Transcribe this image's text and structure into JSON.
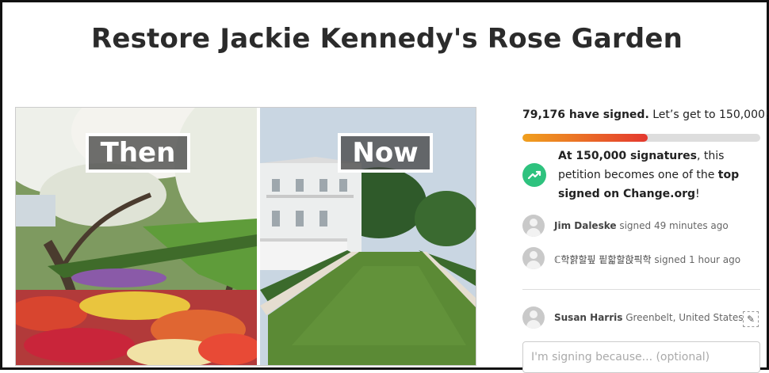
{
  "petition": {
    "title": "Restore Jackie Kennedy's Rose Garden"
  },
  "hero": {
    "then_label": "Then",
    "now_label": "Now"
  },
  "progress": {
    "signed_count": "79,176 have signed.",
    "goal_text": " Let’s get to 150,000!",
    "fraction": 0.528,
    "bar_color_start": "#f0a01e",
    "bar_color_end": "#e4382f"
  },
  "milestone": {
    "icon": "trending-up-icon",
    "part1": "At 150,000 signatures",
    "part2": ", this petition becomes one of the ",
    "part3": "top signed on Change.org",
    "part4": "!",
    "icon_color": "#2ec27e"
  },
  "recent_signers": [
    {
      "name": "Jim Daleske",
      "action": " signed 49 minutes ago"
    },
    {
      "name": "ℂ학햙할핖 핕핣할핝픽학",
      "action": " signed 1 hour ago"
    }
  ],
  "current_user": {
    "name": "Susan Harris",
    "location": " Greenbelt, United States"
  },
  "reason_input": {
    "placeholder": "I'm signing because... (optional)"
  }
}
